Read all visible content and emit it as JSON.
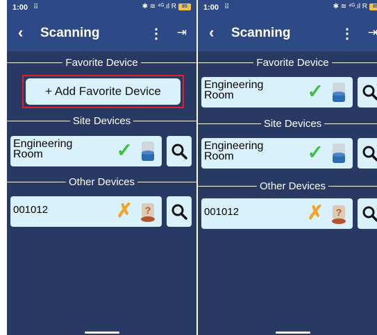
{
  "colors": {
    "background": "#283a63",
    "appbar": "#2d4a86",
    "card": "#d9f1fb",
    "highlight_border": "#e0202a",
    "ok_check": "#3fbf3f",
    "unknown_x": "#f2a52a"
  },
  "left": {
    "status_bar": {
      "time": "1:00",
      "grid_icon": "grid-icon",
      "signal": "✱ ≋ ⁴ᴳ.ıl R",
      "battery": "85"
    },
    "app_bar": {
      "back_icon": "‹",
      "title": "Scanning",
      "more_icon": "⋮",
      "exit_icon": "⇥"
    },
    "favorite_header": "Favorite Device",
    "add_favorite_label": "+ Add Favorite Device",
    "site_header": "Site Devices",
    "site_devices": [
      {
        "name": "Engineering Room",
        "status": "✓",
        "status_kind": "connected",
        "image": "device-icon"
      }
    ],
    "other_header": "Other Devices",
    "other_devices": [
      {
        "name": "001012",
        "status": "✗",
        "status_kind": "unknown",
        "image": "unknown-device-icon"
      }
    ]
  },
  "right": {
    "status_bar": {
      "time": "1:00",
      "grid_icon": "grid-icon",
      "signal": "✱ ≋ ⁴ᴳ.ıl R",
      "battery": "85"
    },
    "app_bar": {
      "back_icon": "‹",
      "title": "Scanning",
      "more_icon": "⋮",
      "exit_icon": "⇥"
    },
    "favorite_header": "Favorite Device",
    "favorite_devices": [
      {
        "name": "Engineering Room",
        "status": "✓",
        "status_kind": "connected",
        "image": "device-icon"
      }
    ],
    "site_header": "Site Devices",
    "site_devices": [
      {
        "name": "Engineering Room",
        "status": "✓",
        "status_kind": "connected",
        "image": "device-icon"
      }
    ],
    "other_header": "Other Devices",
    "other_devices": [
      {
        "name": "001012",
        "status": "✗",
        "status_kind": "unknown",
        "image": "unknown-device-icon"
      }
    ]
  }
}
